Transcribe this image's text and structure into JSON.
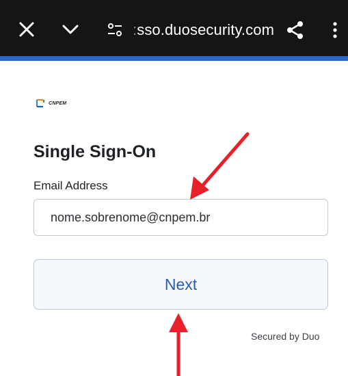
{
  "browser": {
    "url_faded": ":",
    "url": "sso.duosecurity.com",
    "icons": [
      "close-icon",
      "chevron-down-icon",
      "site-settings-icon",
      "share-icon",
      "more-vert-icon"
    ]
  },
  "page": {
    "logo_text": "CNPEM",
    "title": "Single Sign-On",
    "email_label": "Email Address",
    "email_value": "nome.sobrenome@cnpem.br",
    "next_label": "Next",
    "secured_text": "Secured by Duo"
  },
  "colors": {
    "toolbar_bg": "#151515",
    "accent_bar": "#2a66c8",
    "button_text": "#2a5db0",
    "arrow": "#e8202a"
  }
}
